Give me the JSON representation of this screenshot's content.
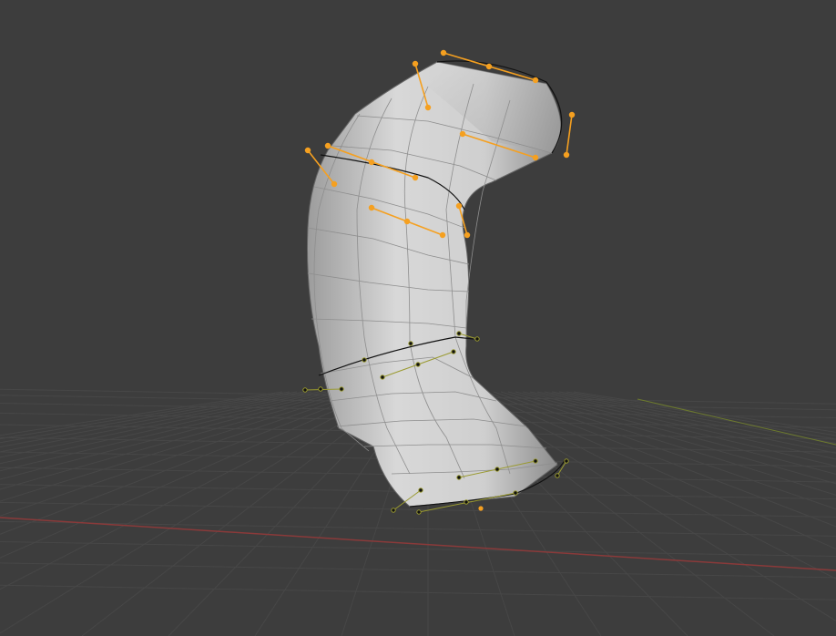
{
  "scene": {
    "background_color": "#3d3d3d",
    "grid_color": "#474747",
    "x_axis_color": "#8a3a3a",
    "y_axis_color": "#6d7a2e",
    "mesh_color": "#d5d5d5",
    "wire_color": "#8e8e8e",
    "selected_color": "#f5a020",
    "unselected_color": "#111111",
    "curve_handle_color": "#9a9a30"
  },
  "object": {
    "name_icon": "bezier-curve-tube-icon",
    "selected_control_points": 8,
    "unselected_control_points": 8
  }
}
